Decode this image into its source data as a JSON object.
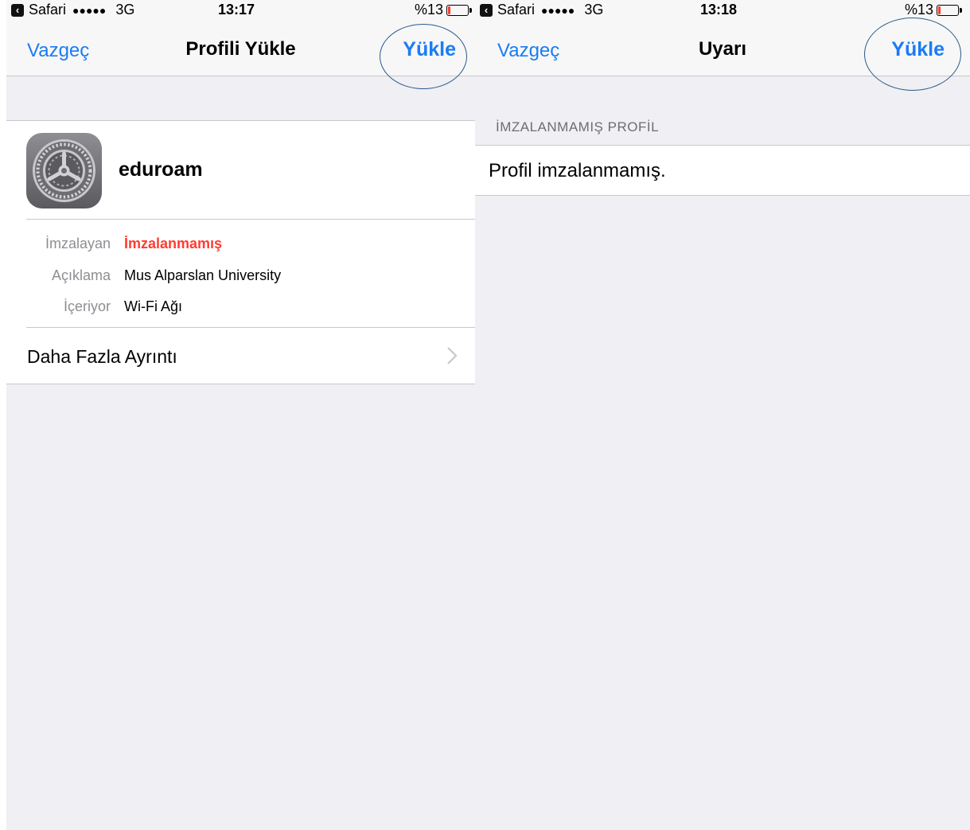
{
  "colors": {
    "ios_blue": "#1a7cf5",
    "red": "#ff3b30",
    "annotation_circle": "#2c5a8a"
  },
  "left": {
    "status": {
      "back_app": "Safari",
      "signal": "●●●●●",
      "network": "3G",
      "time": "13:17",
      "battery_text": "%13",
      "battery_level": 0.13
    },
    "nav": {
      "cancel": "Vazgeç",
      "title": "Profili Yükle",
      "action": "Yükle"
    },
    "profile": {
      "icon": "settings-gear-icon",
      "name": "eduroam",
      "details": [
        {
          "label": "İmzalayan",
          "value": "İmzalanmamış"
        },
        {
          "label": "Açıklama",
          "value": "Mus Alparslan University"
        },
        {
          "label": "İçeriyor",
          "value": "Wi-Fi Ağı"
        }
      ],
      "more": "Daha Fazla Ayrıntı"
    }
  },
  "right": {
    "status": {
      "back_app": "Safari",
      "signal": "●●●●●",
      "network": "3G",
      "time": "13:18",
      "battery_text": "%13",
      "battery_level": 0.13
    },
    "nav": {
      "cancel": "Vazgeç",
      "title": "Uyarı",
      "action": "Yükle"
    },
    "section_header": "İMZALANMAMIŞ PROFİL",
    "row_text": "Profil imzalanmamış."
  }
}
